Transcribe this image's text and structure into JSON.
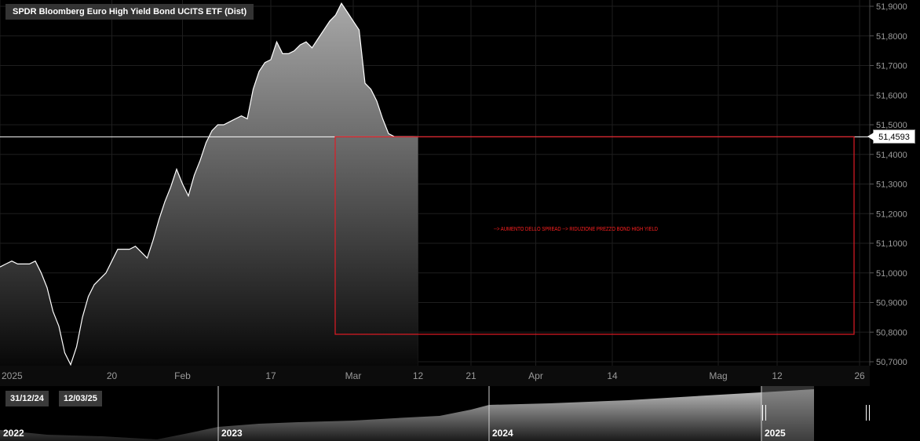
{
  "header": {
    "title": "SPDR Bloomberg Euro High Yield Bond UCITS ETF (Dist)",
    "current_price_label": "51,4593"
  },
  "range": {
    "from": "31/12/24",
    "to": "12/03/25"
  },
  "annotation": {
    "text": "--> AUMENTO DELLO SPREAD --> RIDUZIONE PREZZO BOND HIGH YIELD",
    "color": "#ff2020"
  },
  "colors": {
    "line": "#ffffff",
    "fill_top": "#9a9a9a",
    "fill_bottom": "#0a0a0a",
    "grid": "#1e1e1e",
    "axis_text": "#9a9a9a",
    "annotation_box": "#e01b24"
  },
  "chart_data": [
    {
      "type": "area",
      "title": "SPDR Bloomberg Euro High Yield Bond UCITS ETF (Dist)",
      "xlabel": "",
      "ylabel": "",
      "ylim": [
        50.7,
        51.92
      ],
      "y_ticks": [
        "51,9000",
        "51,8000",
        "51,7000",
        "51,6000",
        "51,5000",
        "51,4000",
        "51,3000",
        "51,2000",
        "51,1000",
        "51,0000",
        "50,9000",
        "50,8000",
        "50,7000"
      ],
      "y_tick_values": [
        51.9,
        51.8,
        51.7,
        51.6,
        51.5,
        51.4,
        51.3,
        51.2,
        51.1,
        51.0,
        50.9,
        50.8,
        50.7
      ],
      "x_ticks": [
        "2025",
        "20",
        "Feb",
        "17",
        "Mar",
        "12",
        "21",
        "Apr",
        "14",
        "Mag",
        "12",
        "26"
      ],
      "x_tick_days": [
        0,
        19,
        31,
        46,
        60,
        71,
        80,
        91,
        104,
        122,
        132,
        146
      ],
      "current_value": 51.4593,
      "grid": true,
      "series": [
        {
          "x_days": [
            0,
            1,
            2,
            3,
            4,
            5,
            6,
            7,
            8,
            9,
            10,
            11,
            12,
            13,
            14,
            15,
            16,
            17,
            18,
            19,
            20,
            21,
            22,
            23,
            24,
            25,
            26,
            27,
            28,
            29,
            30,
            31,
            32,
            33,
            34,
            35,
            36,
            37,
            38,
            39,
            40,
            41,
            42,
            43,
            44,
            45,
            46,
            47,
            48,
            49,
            50,
            51,
            52,
            53,
            54,
            55,
            56,
            57,
            58,
            59,
            60,
            61,
            62,
            63,
            64,
            65,
            66,
            67,
            68,
            69,
            70,
            71
          ],
          "values": [
            51.02,
            51.03,
            51.04,
            51.03,
            51.03,
            51.03,
            51.04,
            51.0,
            50.95,
            50.87,
            50.82,
            50.73,
            50.69,
            50.75,
            50.85,
            50.92,
            50.96,
            50.98,
            51.0,
            51.04,
            51.08,
            51.08,
            51.08,
            51.09,
            51.07,
            51.05,
            51.11,
            51.18,
            51.24,
            51.29,
            51.35,
            51.3,
            51.26,
            51.33,
            51.38,
            51.44,
            51.48,
            51.5,
            51.5,
            51.51,
            51.52,
            51.53,
            51.52,
            51.62,
            51.68,
            51.71,
            51.72,
            51.78,
            51.74,
            51.74,
            51.75,
            51.77,
            51.78,
            51.76,
            51.79,
            51.82,
            51.85,
            51.87,
            51.91,
            51.88,
            51.85,
            51.82,
            51.64,
            51.62,
            51.58,
            51.52,
            51.47,
            51.46,
            51.46,
            51.46,
            51.46,
            51.4593
          ]
        }
      ]
    },
    {
      "type": "area",
      "title": "",
      "x_ticks": [
        "2022",
        "2023",
        "2024",
        "2025"
      ],
      "selected_range": [
        "31/12/24",
        "12/03/25"
      ]
    }
  ]
}
